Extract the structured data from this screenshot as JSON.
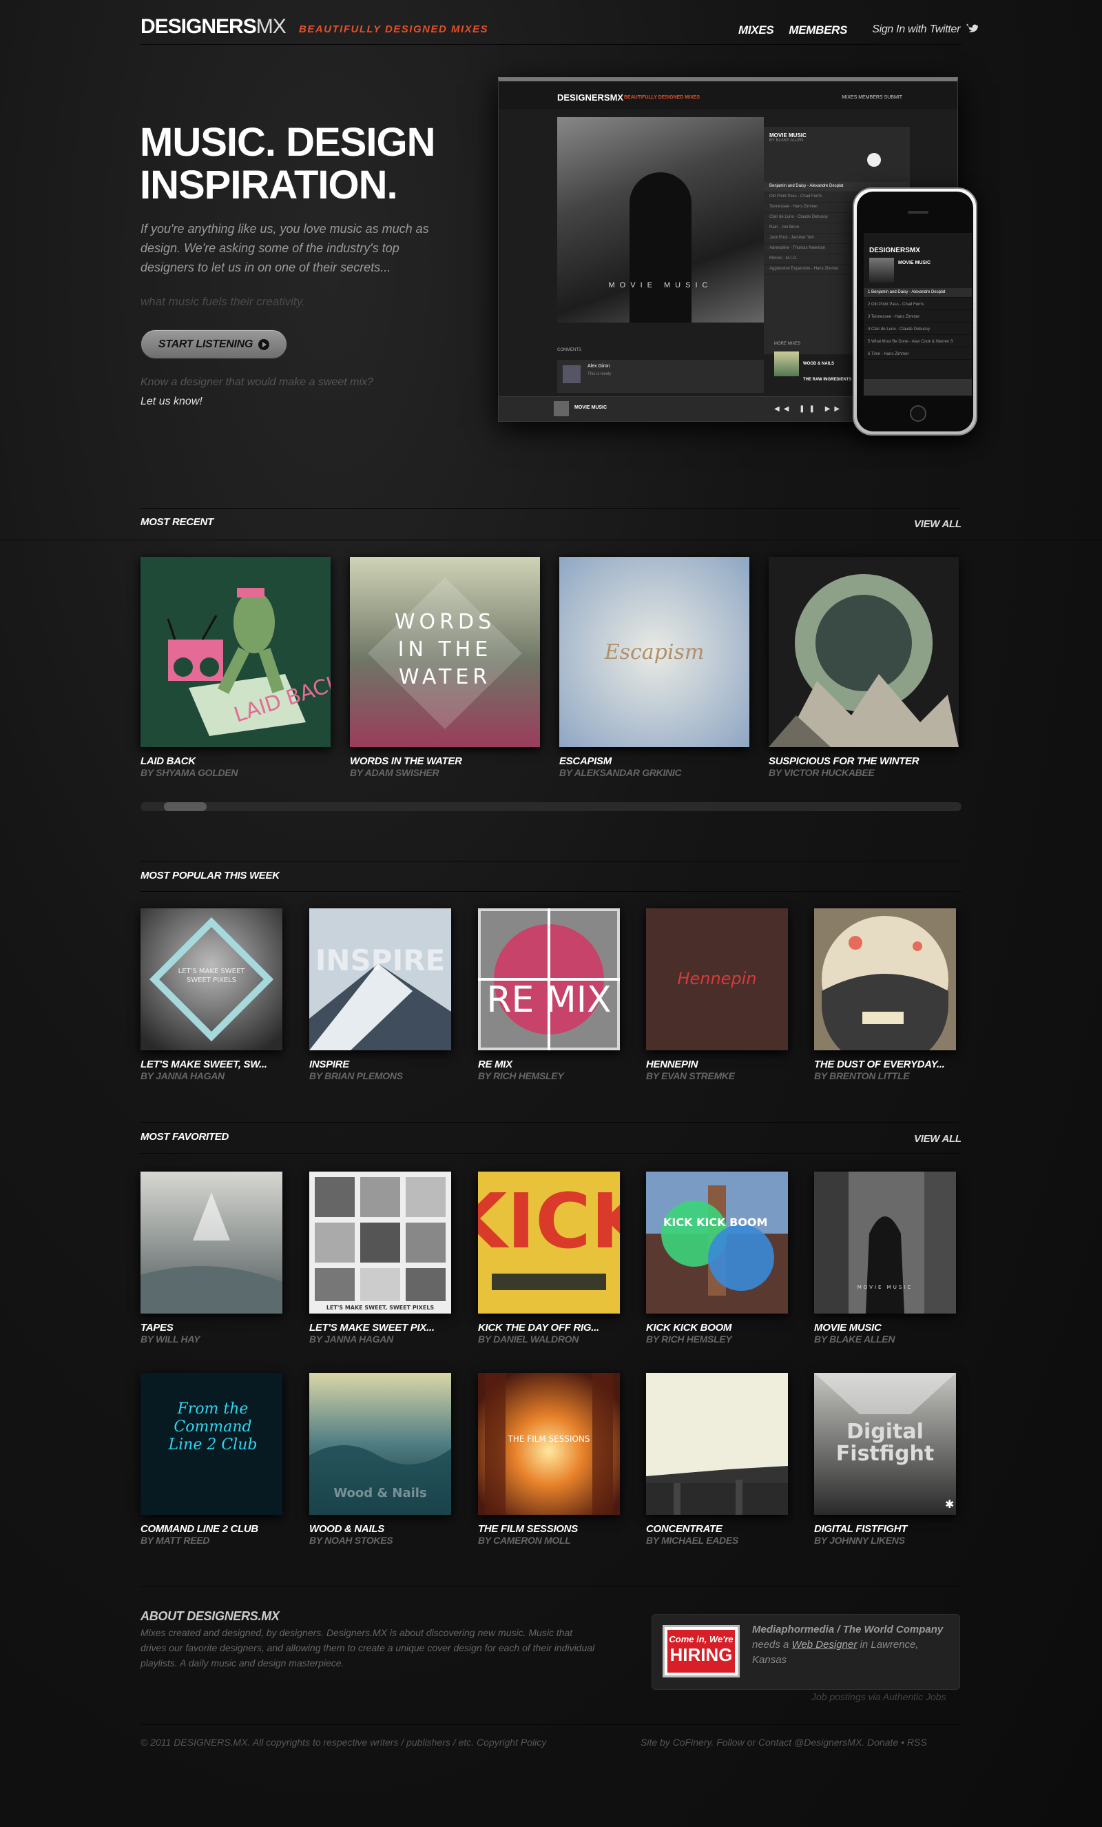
{
  "header": {
    "logo_main": "DESIGNERS",
    "logo_mx": "MX",
    "tagline": "BEAUTIFULLY DESIGNED MIXES",
    "nav": [
      "MIXES",
      "MEMBERS"
    ],
    "signin": "Sign In with Twitter"
  },
  "hero": {
    "title": "MUSIC. DESIGN INSPIRATION.",
    "intro": "If you're anything like us, you love music as much as design. We're asking some of the industry's top designers to let us in on one of their secrets...",
    "sub": "what music fuels their creativity.",
    "button": "START LISTENING",
    "know": "Know a designer that would make a sweet mix?",
    "let_us": "Let us know!"
  },
  "mockup": {
    "logo": "DESIGNERSMX",
    "tagline": "BEAUTIFULLY DESIGNED MIXES",
    "nav": "MIXES   MEMBERS   SUBMIT",
    "cover_text": "MOVIE MUSIC",
    "panel_title": "MOVIE MUSIC",
    "panel_by": "BY BLAKE ALLEN",
    "tracks": [
      "Benjamin and Daisy - Alexandre Desplat",
      "Old Point Pass - Chad Ferris",
      "Tennessee - Hans Zimmer",
      "Clair de Lune - Claude Debussy",
      "Rain - Jon Brion",
      "Jack Pool - Jammer Yeh",
      "Adrenaline - Thomas Newman",
      "Mirrors - M.I.O.",
      "Aggressive Expansion - Hans Zimmer"
    ],
    "comments_label": "COMMENTS",
    "comment_author": "Alex Giron",
    "comment_text": "This is lovely",
    "more_label": "MORE MIXES",
    "more_1": "WOOD & NAILS",
    "more_2": "THE RAW INGREDIENTS",
    "player_title": "MOVIE MUSIC"
  },
  "phone": {
    "logo": "DESIGNERSMX",
    "title": "MOVIE MUSIC",
    "tracks": [
      "1 Benjamin and Daisy - Alexandre Desplat",
      "2 Old Point Pass - Chad Ferris",
      "3 Tennessee - Hans Zimmer",
      "4 Clair de Lune - Claude Debussy",
      "5 What Must Be Done - Alan Cook & Warren S",
      "6 Time - Hans Zimmer"
    ]
  },
  "most_recent": {
    "title": "MOST RECENT",
    "view_all": "VIEW ALL",
    "scroll_position": 0.03,
    "items": [
      {
        "title": "LAID BACK",
        "by": "BY SHYAMA GOLDEN",
        "cover_text": "LAID BACK"
      },
      {
        "title": "WORDS IN THE WATER",
        "by": "BY ADAM SWISHER",
        "cover_text": "WORDS IN THE WATER"
      },
      {
        "title": "ESCAPISM",
        "by": "BY ALEKSANDAR GRKINIC",
        "cover_text": "Escapism"
      },
      {
        "title": "SUSPICIOUS FOR THE WINTER",
        "by": "BY VICTOR HUCKABEE",
        "cover_text": ""
      }
    ]
  },
  "most_popular": {
    "title": "MOST POPULAR THIS WEEK",
    "items": [
      {
        "title": "LET'S MAKE SWEET, SW...",
        "by": "BY JANNA HAGAN",
        "cover_text": "LET'S MAKE SWEET SWEET PIXELS"
      },
      {
        "title": "INSPIRE",
        "by": "BY BRIAN PLEMONS",
        "cover_text": "INSPIRE"
      },
      {
        "title": "RE MIX",
        "by": "BY RICH HEMSLEY",
        "cover_text": "RE MIX"
      },
      {
        "title": "HENNEPIN",
        "by": "BY EVAN STREMKE",
        "cover_text": "Hennepin"
      },
      {
        "title": "THE DUST OF EVERYDAY...",
        "by": "BY BRENTON LITTLE",
        "cover_text": ""
      }
    ]
  },
  "most_favorited": {
    "title": "MOST FAVORITED",
    "view_all": "VIEW ALL",
    "items": [
      {
        "title": "TAPES",
        "by": "BY WILL HAY",
        "cover_text": ""
      },
      {
        "title": "LET'S MAKE SWEET PIX...",
        "by": "BY JANNA HAGAN",
        "cover_text": "LET'S MAKE SWEET, SWEET PIXELS"
      },
      {
        "title": "KICK THE DAY OFF RIG...",
        "by": "BY DANIEL WALDRON",
        "cover_text": "KICK"
      },
      {
        "title": "KICK KICK BOOM",
        "by": "BY RICH HEMSLEY",
        "cover_text": "KICK KICK BOOM"
      },
      {
        "title": "MOVIE MUSIC",
        "by": "BY BLAKE ALLEN",
        "cover_text": "MOVIE MUSIC"
      },
      {
        "title": "COMMAND LINE 2 CLUB",
        "by": "BY MATT REED",
        "cover_text": "From the Command Line 2 Club"
      },
      {
        "title": "WOOD & NAILS",
        "by": "BY NOAH STOKES",
        "cover_text": "Wood & Nails"
      },
      {
        "title": "THE FILM SESSIONS",
        "by": "BY CAMERON MOLL",
        "cover_text": "THE FILM SESSIONS"
      },
      {
        "title": "CONCENTRATE",
        "by": "BY MICHAEL EADES",
        "cover_text": ""
      },
      {
        "title": "DIGITAL FISTFIGHT",
        "by": "BY JOHNNY LIKENS",
        "cover_text": "Digital Fistfight"
      }
    ]
  },
  "about": {
    "title": "ABOUT DESIGNERS.MX",
    "text": "Mixes created and designed, by designers. Designers.MX is about discovering new music. Music that drives our favorite designers, and allowing them to create a unique cover design for each of their individual playlists. A daily music and design masterpiece."
  },
  "hiring": {
    "badge_1": "Come in, We're",
    "badge_2": "HIRING",
    "company": "Mediaphormedia / The World Company",
    "needs": "needs a",
    "role": "Web Designer",
    "location": "in Lawrence, Kansas",
    "source": "Job postings via Authentic Jobs"
  },
  "footer": {
    "copyright": "© 2011 DESIGNERS.MX. All copyrights to respective writers / publishers / etc. Copyright Policy",
    "credits": "Site by CoFinery. Follow or Contact @DesignersMX.   Donate • RSS"
  },
  "colors": {
    "accent": "#e5502a",
    "background": "#0e0e0e",
    "hiring_red": "#d81e26"
  }
}
